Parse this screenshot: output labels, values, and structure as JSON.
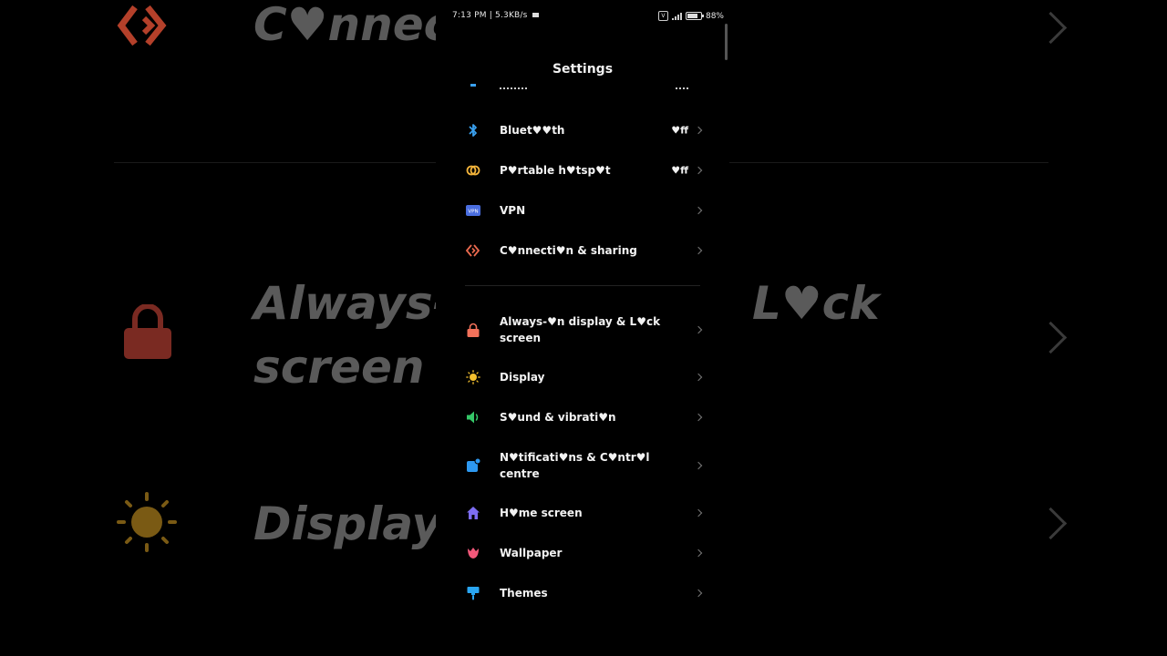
{
  "status_bar": {
    "time": "7:13 PM",
    "speed": "5.3KB/s",
    "battery": "88%"
  },
  "header": {
    "title": "Settings"
  },
  "background_mirror": {
    "connection_text": "C♥nnecti",
    "always_on_text_line1": "Always-",
    "always_on_text_line2": "screen",
    "lock_text": "L♥ck",
    "display_text": "Display"
  },
  "settings_items": [
    {
      "label": "Bluet♥♥th",
      "value": "♥ff",
      "icon": "bluetooth-icon",
      "color": "#3aa1f0"
    },
    {
      "label": "P♥rtable h♥tsp♥t",
      "value": "♥ff",
      "icon": "hotspot-icon",
      "color": "#f3b43b"
    },
    {
      "label": "VPN",
      "value": "",
      "icon": "vpn-icon",
      "color": "#4a6ee0"
    },
    {
      "label": "C♥nnecti♥n & sharing",
      "value": "",
      "icon": "connection-sharing-icon",
      "color": "#ec6a4f"
    },
    {
      "label": "Always-♥n display & L♥ck screen",
      "value": "",
      "icon": "lock-icon",
      "color": "#f2715a"
    },
    {
      "label": "Display",
      "value": "",
      "icon": "sun-icon",
      "color": "#f4c02e"
    },
    {
      "label": "S♥und & vibrati♥n",
      "value": "",
      "icon": "speaker-icon",
      "color": "#35c768"
    },
    {
      "label": "N♥tificati♥ns & C♥ntr♥l centre",
      "value": "",
      "icon": "notifications-icon",
      "color": "#2d98f0"
    },
    {
      "label": "H♥me screen",
      "value": "",
      "icon": "home-icon",
      "color": "#7d6df2"
    },
    {
      "label": "Wallpaper",
      "value": "",
      "icon": "tulip-icon",
      "color": "#f2587a"
    },
    {
      "label": "Themes",
      "value": "",
      "icon": "paintbrush-icon",
      "color": "#2aa6f2"
    }
  ]
}
